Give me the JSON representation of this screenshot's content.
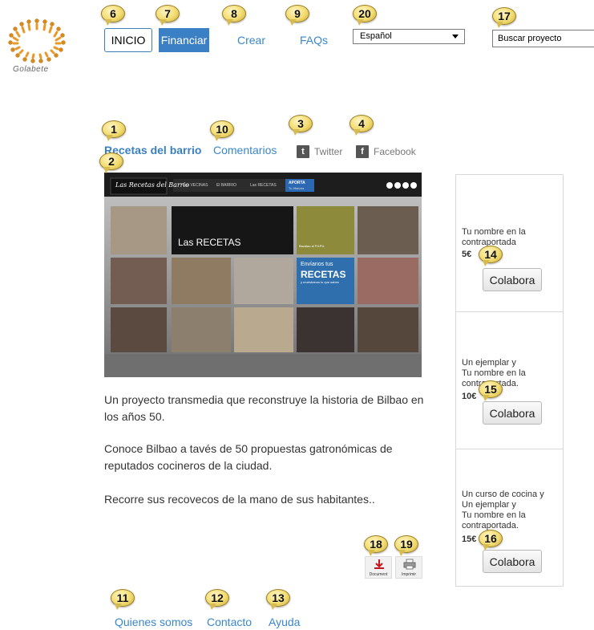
{
  "logo": {
    "text": "Golabete",
    "icon": "people-circle-logo"
  },
  "nav": {
    "inicio": "INICIO",
    "financiar": "Financiar",
    "crear": "Crear",
    "faqs": "FAQs"
  },
  "language": {
    "selected": "Español"
  },
  "search": {
    "value": "Buscar proyecto"
  },
  "project": {
    "title_tab": "Recetas del barrio",
    "comments_tab": "Comentarios",
    "twitter": "Twitter",
    "facebook": "Facebook",
    "image": {
      "site_title": "Las Recetas del Barrio",
      "menu": [
        "Las VECINAS",
        "El BARRIO",
        "Las RECETAS",
        "APORTA"
      ],
      "menu_sub": "Tu Historia",
      "banner": "Las RECETAS",
      "promo_line1": "Envíanos tus",
      "promo_line2": "RECETAS",
      "promo_line3": "y muéstranos lo que sabes",
      "side_caption": "Bacalao al PILPIL"
    },
    "description": [
      "Un proyecto transmedia que reconstruye la historia de Bilbao en los años 50.",
      "Conoce Bilbao a tavés de 50 propuestas gatronómicas de reputados cocineros de la ciudad.",
      "Recorre sus recovecos de la mano de sus habitantes.."
    ],
    "doc_buttons": {
      "document": "Document",
      "print": "Imprimir"
    }
  },
  "rewards": [
    {
      "lines": [
        "Tu nombre en la",
        "contraportada"
      ],
      "price": "5€",
      "button": "Colabora"
    },
    {
      "lines": [
        "Un ejemplar y",
        "Tu nombre en la",
        "contraportada."
      ],
      "price": "10€",
      "button": "Colabora"
    },
    {
      "lines": [
        "Un curso de cocina y",
        "Un ejemplar y",
        "Tu nombre en la",
        "contraportada."
      ],
      "price": "15€",
      "button": "Colabora"
    }
  ],
  "footer": {
    "about": "Quienes somos",
    "contact": "Contacto",
    "help": "Ayuda"
  },
  "callouts": {
    "c1": "1",
    "c2": "2",
    "c3": "3",
    "c4": "4",
    "c6": "6",
    "c7": "7",
    "c8": "8",
    "c9": "9",
    "c10": "10",
    "c11": "11",
    "c12": "12",
    "c13": "13",
    "c14": "14",
    "c15": "15",
    "c16": "16",
    "c17": "17",
    "c18": "18",
    "c19": "19",
    "c20": "20"
  },
  "colors": {
    "accent": "#3b7fc4",
    "link": "#3a87c8",
    "badge": "#f2dc72"
  }
}
